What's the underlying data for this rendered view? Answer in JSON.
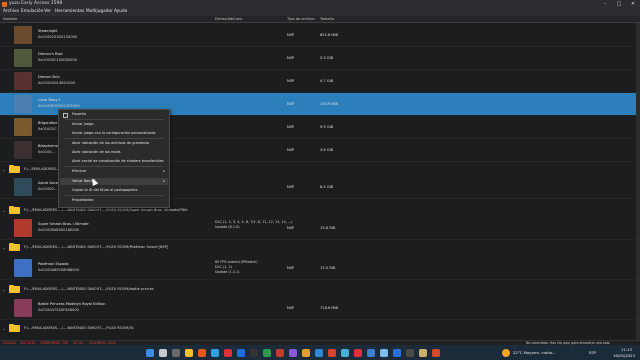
{
  "window": {
    "title": "yuzu Early Access 3598"
  },
  "menu": [
    "Archivo",
    "Emulación",
    "Ver",
    "Herramientas",
    "Multijugador",
    "Ayuda"
  ],
  "columns": {
    "name": "Nombre",
    "addons": "Extras/Add-ons",
    "type": "Tipo de archivo",
    "size": "Tamaño"
  },
  "rows": [
    {
      "name": "Steamlight",
      "tid": "0x0100201D0150000",
      "type": "NSP",
      "size": "852.8 MiB",
      "color": "#6b4a2e"
    },
    {
      "name": "Demon's Rise",
      "tid": "0x01006C100E80000",
      "type": "NSP",
      "size": "3.3 GiB",
      "color": "#4e5a3a"
    },
    {
      "name": "Demon Skin",
      "tid": "0x01000D14B01000",
      "type": "NSP",
      "size": "4.7 GiB",
      "color": "#5a3030"
    },
    {
      "name": "Cave Story+",
      "tid": "0x0100B7D0022EE000",
      "type": "NSP",
      "size": "134.9 MiB",
      "color": "#4d7fb0",
      "selected": true
    },
    {
      "name": "Brigandine",
      "tid": "0x01002C...",
      "type": "NSP",
      "size": "9.5 GiB",
      "color": "#7a5a2e"
    },
    {
      "name": "Blasphemous",
      "tid": "0x0100...",
      "type": "NSP",
      "size": "3.6 GiB",
      "color": "#3b2f2f"
    }
  ],
  "folder1": {
    "path": "F:/...EMULADORES-.../..."
  },
  "row_astral": {
    "name": "Astral Asce...",
    "tid": "0x01000...",
    "type": "NSP",
    "size": "8.5 GiB",
    "color": "#2f4a5a"
  },
  "folder2": {
    "path": "F:/.../EMULADORES-.../...-NINTENDO SWICHT-.../YUZU ROOM/Super Smash Bros. Ultimate/Title"
  },
  "row_smash": {
    "name": "Super Smash Bros. Ultimate",
    "tid": "0x01006A800016E000",
    "addon1": "DLC (1, 2, 3, 4, 5, 6, 7/1, 8, 11, 12, 13, 14, ...)",
    "addon2": "Update (8.1.0)",
    "type": "NSP",
    "size": "13.6 GiB",
    "color": "#b03a2e"
  },
  "folder3": {
    "path": "F:/.../EMULADORES-.../...-NINTENDO SWICHT-.../YUZU ROOM/Pokémon Sword [NSP]"
  },
  "row_pokemon": {
    "name": "Pokémon Espada",
    "tid": "0x0100ABF008968000",
    "addon1": "60 FPS overrid (IPSwitch)",
    "addon2": "DLC (1, 2)",
    "addon3": "Update (1.3.1)",
    "type": "NSP",
    "size": "13.5 GiB",
    "color": "#3d6fc2"
  },
  "folder4": {
    "path": "F:/.../EMULADORES-.../...-NINTENDO SWICHT-.../YUZU ROOM/battle princes"
  },
  "row_battle": {
    "name": "Battle Princess Madelyn Royal Edition",
    "tid": "0x0100A7500F648000",
    "type": "NSP",
    "size": "718.6 MiB",
    "color": "#8a3a5a"
  },
  "folder5": {
    "path": "F:/.../EMULADORES-.../...-NINTENDO SWICHT-.../YUZU ROOM/01"
  },
  "context_menu": {
    "favorite": "Favorito",
    "items": [
      "Iniciar juego",
      "Iniciar juego con la configuración personalizada",
      "Abrir ubicación de los archivos de guardado",
      "Abrir ubicación de los mods",
      "Abrir caché de canalización de shaders transferibles",
      "Eliminar",
      "Volcar RomFS",
      "Copiar la ID del título al portapapeles",
      "Propiedades"
    ]
  },
  "status": {
    "left": "VULKAN",
    "gpu": "GPU ALTA",
    "docked": "SOBREMESA",
    "fsr": "FSR",
    "aa": "NO AA",
    "volume": "VOLUMEN: 100%",
    "right": "No conectado. Haz clic aquí para encontrar una sala."
  },
  "taskbar": {
    "weather": "22°C  Mayorm. nubla...",
    "lang": "ESP",
    "time": "11:13",
    "date": "16/05/2023"
  }
}
